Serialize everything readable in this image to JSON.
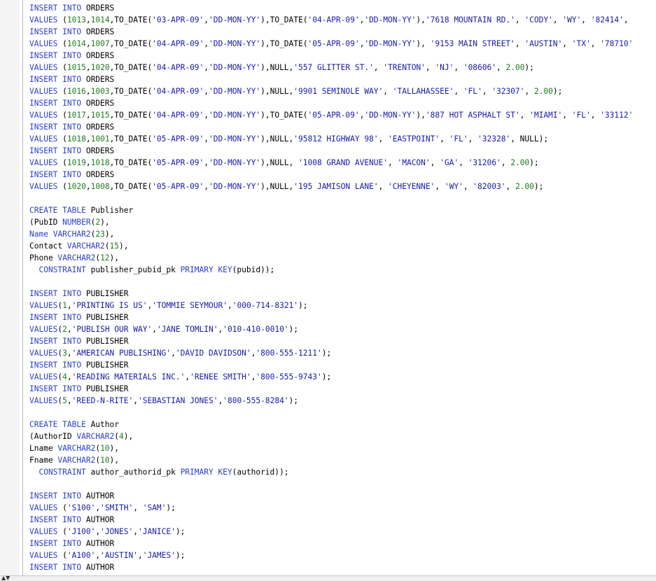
{
  "editor": {
    "collapse_icon": "▲▼",
    "lines": [
      [
        [
          "kw",
          "INSERT INTO"
        ],
        [
          "t",
          " ORDERS"
        ]
      ],
      [
        [
          "kw",
          "VALUES"
        ],
        [
          "t",
          " ("
        ],
        [
          "num",
          "1013"
        ],
        [
          "t",
          ","
        ],
        [
          "num",
          "1014"
        ],
        [
          "t",
          ",TO_DATE("
        ],
        [
          "str",
          "'03-APR-09'"
        ],
        [
          "t",
          ","
        ],
        [
          "str",
          "'DD-MON-YY'"
        ],
        [
          "t",
          "),TO_DATE("
        ],
        [
          "str",
          "'04-APR-09'"
        ],
        [
          "t",
          ","
        ],
        [
          "str",
          "'DD-MON-YY'"
        ],
        [
          "t",
          "),"
        ],
        [
          "str",
          "'7618 MOUNTAIN RD.'"
        ],
        [
          "t",
          ", "
        ],
        [
          "str",
          "'CODY'"
        ],
        [
          "t",
          ", "
        ],
        [
          "str",
          "'WY'"
        ],
        [
          "t",
          ", "
        ],
        [
          "str",
          "'82414'"
        ],
        [
          "t",
          ","
        ]
      ],
      [
        [
          "kw",
          "INSERT INTO"
        ],
        [
          "t",
          " ORDERS"
        ]
      ],
      [
        [
          "kw",
          "VALUES"
        ],
        [
          "t",
          " ("
        ],
        [
          "num",
          "1014"
        ],
        [
          "t",
          ","
        ],
        [
          "num",
          "1007"
        ],
        [
          "t",
          ",TO_DATE("
        ],
        [
          "str",
          "'04-APR-09'"
        ],
        [
          "t",
          ","
        ],
        [
          "str",
          "'DD-MON-YY'"
        ],
        [
          "t",
          "),TO_DATE("
        ],
        [
          "str",
          "'05-APR-09'"
        ],
        [
          "t",
          ","
        ],
        [
          "str",
          "'DD-MON-YY'"
        ],
        [
          "t",
          "), "
        ],
        [
          "str",
          "'9153 MAIN STREET'"
        ],
        [
          "t",
          ", "
        ],
        [
          "str",
          "'AUSTIN'"
        ],
        [
          "t",
          ", "
        ],
        [
          "str",
          "'TX'"
        ],
        [
          "t",
          ", "
        ],
        [
          "str",
          "'78710'"
        ]
      ],
      [
        [
          "kw",
          "INSERT INTO"
        ],
        [
          "t",
          " ORDERS"
        ]
      ],
      [
        [
          "kw",
          "VALUES"
        ],
        [
          "t",
          " ("
        ],
        [
          "num",
          "1015"
        ],
        [
          "t",
          ","
        ],
        [
          "num",
          "1020"
        ],
        [
          "t",
          ",TO_DATE("
        ],
        [
          "str",
          "'04-APR-09'"
        ],
        [
          "t",
          ","
        ],
        [
          "str",
          "'DD-MON-YY'"
        ],
        [
          "t",
          "),NULL,"
        ],
        [
          "str",
          "'557 GLITTER ST.'"
        ],
        [
          "t",
          ", "
        ],
        [
          "str",
          "'TRENTON'"
        ],
        [
          "t",
          ", "
        ],
        [
          "str",
          "'NJ'"
        ],
        [
          "t",
          ", "
        ],
        [
          "str",
          "'08606'"
        ],
        [
          "t",
          ", "
        ],
        [
          "num",
          "2.00"
        ],
        [
          "t",
          ");"
        ]
      ],
      [
        [
          "kw",
          "INSERT INTO"
        ],
        [
          "t",
          " ORDERS"
        ]
      ],
      [
        [
          "kw",
          "VALUES"
        ],
        [
          "t",
          " ("
        ],
        [
          "num",
          "1016"
        ],
        [
          "t",
          ","
        ],
        [
          "num",
          "1003"
        ],
        [
          "t",
          ",TO_DATE("
        ],
        [
          "str",
          "'04-APR-09'"
        ],
        [
          "t",
          ","
        ],
        [
          "str",
          "'DD-MON-YY'"
        ],
        [
          "t",
          "),NULL,"
        ],
        [
          "str",
          "'9901 SEMINOLE WAY'"
        ],
        [
          "t",
          ", "
        ],
        [
          "str",
          "'TALLAHASSEE'"
        ],
        [
          "t",
          ", "
        ],
        [
          "str",
          "'FL'"
        ],
        [
          "t",
          ", "
        ],
        [
          "str",
          "'32307'"
        ],
        [
          "t",
          ", "
        ],
        [
          "num",
          "2.00"
        ],
        [
          "t",
          ");"
        ]
      ],
      [
        [
          "kw",
          "INSERT INTO"
        ],
        [
          "t",
          " ORDERS"
        ]
      ],
      [
        [
          "kw",
          "VALUES"
        ],
        [
          "t",
          " ("
        ],
        [
          "num",
          "1017"
        ],
        [
          "t",
          ","
        ],
        [
          "num",
          "1015"
        ],
        [
          "t",
          ",TO_DATE("
        ],
        [
          "str",
          "'04-APR-09'"
        ],
        [
          "t",
          ","
        ],
        [
          "str",
          "'DD-MON-YY'"
        ],
        [
          "t",
          "),TO_DATE("
        ],
        [
          "str",
          "'05-APR-09'"
        ],
        [
          "t",
          ","
        ],
        [
          "str",
          "'DD-MON-YY'"
        ],
        [
          "t",
          "),"
        ],
        [
          "str",
          "'887 HOT ASPHALT ST'"
        ],
        [
          "t",
          ", "
        ],
        [
          "str",
          "'MIAMI'"
        ],
        [
          "t",
          ", "
        ],
        [
          "str",
          "'FL'"
        ],
        [
          "t",
          ", "
        ],
        [
          "str",
          "'33112'"
        ]
      ],
      [
        [
          "kw",
          "INSERT INTO"
        ],
        [
          "t",
          " ORDERS"
        ]
      ],
      [
        [
          "kw",
          "VALUES"
        ],
        [
          "t",
          " ("
        ],
        [
          "num",
          "1018"
        ],
        [
          "t",
          ","
        ],
        [
          "num",
          "1001"
        ],
        [
          "t",
          ",TO_DATE("
        ],
        [
          "str",
          "'05-APR-09'"
        ],
        [
          "t",
          ","
        ],
        [
          "str",
          "'DD-MON-YY'"
        ],
        [
          "t",
          "),NULL,"
        ],
        [
          "str",
          "'95812 HIGHWAY 98'"
        ],
        [
          "t",
          ", "
        ],
        [
          "str",
          "'EASTPOINT'"
        ],
        [
          "t",
          ", "
        ],
        [
          "str",
          "'FL'"
        ],
        [
          "t",
          ", "
        ],
        [
          "str",
          "'32328'"
        ],
        [
          "t",
          ", NULL);"
        ]
      ],
      [
        [
          "kw",
          "INSERT INTO"
        ],
        [
          "t",
          " ORDERS"
        ]
      ],
      [
        [
          "kw",
          "VALUES"
        ],
        [
          "t",
          " ("
        ],
        [
          "num",
          "1019"
        ],
        [
          "t",
          ","
        ],
        [
          "num",
          "1018"
        ],
        [
          "t",
          ",TO_DATE("
        ],
        [
          "str",
          "'05-APR-09'"
        ],
        [
          "t",
          ","
        ],
        [
          "str",
          "'DD-MON-YY'"
        ],
        [
          "t",
          "),NULL, "
        ],
        [
          "str",
          "'1008 GRAND AVENUE'"
        ],
        [
          "t",
          ", "
        ],
        [
          "str",
          "'MACON'"
        ],
        [
          "t",
          ", "
        ],
        [
          "str",
          "'GA'"
        ],
        [
          "t",
          ", "
        ],
        [
          "str",
          "'31206'"
        ],
        [
          "t",
          ", "
        ],
        [
          "num",
          "2.00"
        ],
        [
          "t",
          ");"
        ]
      ],
      [
        [
          "kw",
          "INSERT INTO"
        ],
        [
          "t",
          " ORDERS"
        ]
      ],
      [
        [
          "kw",
          "VALUES"
        ],
        [
          "t",
          " ("
        ],
        [
          "num",
          "1020"
        ],
        [
          "t",
          ","
        ],
        [
          "num",
          "1008"
        ],
        [
          "t",
          ",TO_DATE("
        ],
        [
          "str",
          "'05-APR-09'"
        ],
        [
          "t",
          ","
        ],
        [
          "str",
          "'DD-MON-YY'"
        ],
        [
          "t",
          "),NULL,"
        ],
        [
          "str",
          "'195 JAMISON LANE'"
        ],
        [
          "t",
          ", "
        ],
        [
          "str",
          "'CHEYENNE'"
        ],
        [
          "t",
          ", "
        ],
        [
          "str",
          "'WY'"
        ],
        [
          "t",
          ", "
        ],
        [
          "str",
          "'82003'"
        ],
        [
          "t",
          ", "
        ],
        [
          "num",
          "2.00"
        ],
        [
          "t",
          ");"
        ]
      ],
      [],
      [
        [
          "kw",
          "CREATE TABLE"
        ],
        [
          "t",
          " Publisher"
        ]
      ],
      [
        [
          "t",
          "(PubID "
        ],
        [
          "kw",
          "NUMBER"
        ],
        [
          "t",
          "("
        ],
        [
          "num",
          "2"
        ],
        [
          "t",
          "),"
        ]
      ],
      [
        [
          "kw",
          "Name"
        ],
        [
          "t",
          " "
        ],
        [
          "kw",
          "VARCHAR2"
        ],
        [
          "t",
          "("
        ],
        [
          "num",
          "23"
        ],
        [
          "t",
          "),"
        ]
      ],
      [
        [
          "t",
          "Contact "
        ],
        [
          "kw",
          "VARCHAR2"
        ],
        [
          "t",
          "("
        ],
        [
          "num",
          "15"
        ],
        [
          "t",
          "),"
        ]
      ],
      [
        [
          "t",
          "Phone "
        ],
        [
          "kw",
          "VARCHAR2"
        ],
        [
          "t",
          "("
        ],
        [
          "num",
          "12"
        ],
        [
          "t",
          "),"
        ]
      ],
      [
        [
          "t",
          "  "
        ],
        [
          "kw",
          "CONSTRAINT"
        ],
        [
          "t",
          " publisher_pubid_pk "
        ],
        [
          "kw",
          "PRIMARY KEY"
        ],
        [
          "t",
          "(pubid));"
        ]
      ],
      [],
      [
        [
          "kw",
          "INSERT INTO"
        ],
        [
          "t",
          " PUBLISHER"
        ]
      ],
      [
        [
          "kw",
          "VALUES"
        ],
        [
          "t",
          "("
        ],
        [
          "num",
          "1"
        ],
        [
          "t",
          ","
        ],
        [
          "str",
          "'PRINTING IS US'"
        ],
        [
          "t",
          ","
        ],
        [
          "str",
          "'TOMMIE SEYMOUR'"
        ],
        [
          "t",
          ","
        ],
        [
          "str",
          "'000-714-8321'"
        ],
        [
          "t",
          ");"
        ]
      ],
      [
        [
          "kw",
          "INSERT INTO"
        ],
        [
          "t",
          " PUBLISHER"
        ]
      ],
      [
        [
          "kw",
          "VALUES"
        ],
        [
          "t",
          "("
        ],
        [
          "num",
          "2"
        ],
        [
          "t",
          ","
        ],
        [
          "str",
          "'PUBLISH OUR WAY'"
        ],
        [
          "t",
          ","
        ],
        [
          "str",
          "'JANE TOMLIN'"
        ],
        [
          "t",
          ","
        ],
        [
          "str",
          "'010-410-0010'"
        ],
        [
          "t",
          ");"
        ]
      ],
      [
        [
          "kw",
          "INSERT INTO"
        ],
        [
          "t",
          " PUBLISHER"
        ]
      ],
      [
        [
          "kw",
          "VALUES"
        ],
        [
          "t",
          "("
        ],
        [
          "num",
          "3"
        ],
        [
          "t",
          ","
        ],
        [
          "str",
          "'AMERICAN PUBLISHING'"
        ],
        [
          "t",
          ","
        ],
        [
          "str",
          "'DAVID DAVIDSON'"
        ],
        [
          "t",
          ","
        ],
        [
          "str",
          "'800-555-1211'"
        ],
        [
          "t",
          ");"
        ]
      ],
      [
        [
          "kw",
          "INSERT INTO"
        ],
        [
          "t",
          " PUBLISHER"
        ]
      ],
      [
        [
          "kw",
          "VALUES"
        ],
        [
          "t",
          "("
        ],
        [
          "num",
          "4"
        ],
        [
          "t",
          ","
        ],
        [
          "str",
          "'READING MATERIALS INC.'"
        ],
        [
          "t",
          ","
        ],
        [
          "str",
          "'RENEE SMITH'"
        ],
        [
          "t",
          ","
        ],
        [
          "str",
          "'800-555-9743'"
        ],
        [
          "t",
          ");"
        ]
      ],
      [
        [
          "kw",
          "INSERT INTO"
        ],
        [
          "t",
          " PUBLISHER"
        ]
      ],
      [
        [
          "kw",
          "VALUES"
        ],
        [
          "t",
          "("
        ],
        [
          "num",
          "5"
        ],
        [
          "t",
          ","
        ],
        [
          "str",
          "'REED-N-RITE'"
        ],
        [
          "t",
          ","
        ],
        [
          "str",
          "'SEBASTIAN JONES'"
        ],
        [
          "t",
          ","
        ],
        [
          "str",
          "'800-555-8284'"
        ],
        [
          "t",
          ");"
        ]
      ],
      [],
      [
        [
          "kw",
          "CREATE TABLE"
        ],
        [
          "t",
          " Author"
        ]
      ],
      [
        [
          "t",
          "(AuthorID "
        ],
        [
          "kw",
          "VARCHAR2"
        ],
        [
          "t",
          "("
        ],
        [
          "num",
          "4"
        ],
        [
          "t",
          "),"
        ]
      ],
      [
        [
          "t",
          "Lname "
        ],
        [
          "kw",
          "VARCHAR2"
        ],
        [
          "t",
          "("
        ],
        [
          "num",
          "10"
        ],
        [
          "t",
          "),"
        ]
      ],
      [
        [
          "t",
          "Fname "
        ],
        [
          "kw",
          "VARCHAR2"
        ],
        [
          "t",
          "("
        ],
        [
          "num",
          "10"
        ],
        [
          "t",
          "),"
        ]
      ],
      [
        [
          "t",
          "  "
        ],
        [
          "kw",
          "CONSTRAINT"
        ],
        [
          "t",
          " author_authorid_pk "
        ],
        [
          "kw",
          "PRIMARY KEY"
        ],
        [
          "t",
          "(authorid));"
        ]
      ],
      [],
      [
        [
          "kw",
          "INSERT INTO"
        ],
        [
          "t",
          " AUTHOR"
        ]
      ],
      [
        [
          "kw",
          "VALUES"
        ],
        [
          "t",
          " ("
        ],
        [
          "str",
          "'S100'"
        ],
        [
          "t",
          ","
        ],
        [
          "str",
          "'SMITH'"
        ],
        [
          "t",
          ", "
        ],
        [
          "str",
          "'SAM'"
        ],
        [
          "t",
          ");"
        ]
      ],
      [
        [
          "kw",
          "INSERT INTO"
        ],
        [
          "t",
          " AUTHOR"
        ]
      ],
      [
        [
          "kw",
          "VALUES"
        ],
        [
          "t",
          " ("
        ],
        [
          "str",
          "'J100'"
        ],
        [
          "t",
          ","
        ],
        [
          "str",
          "'JONES'"
        ],
        [
          "t",
          ","
        ],
        [
          "str",
          "'JANICE'"
        ],
        [
          "t",
          ");"
        ]
      ],
      [
        [
          "kw",
          "INSERT INTO"
        ],
        [
          "t",
          " AUTHOR"
        ]
      ],
      [
        [
          "kw",
          "VALUES"
        ],
        [
          "t",
          " ("
        ],
        [
          "str",
          "'A100'"
        ],
        [
          "t",
          ","
        ],
        [
          "str",
          "'AUSTIN'"
        ],
        [
          "t",
          ","
        ],
        [
          "str",
          "'JAMES'"
        ],
        [
          "t",
          ");"
        ]
      ],
      [
        [
          "kw",
          "INSERT INTO"
        ],
        [
          "t",
          " AUTHOR"
        ]
      ]
    ]
  }
}
